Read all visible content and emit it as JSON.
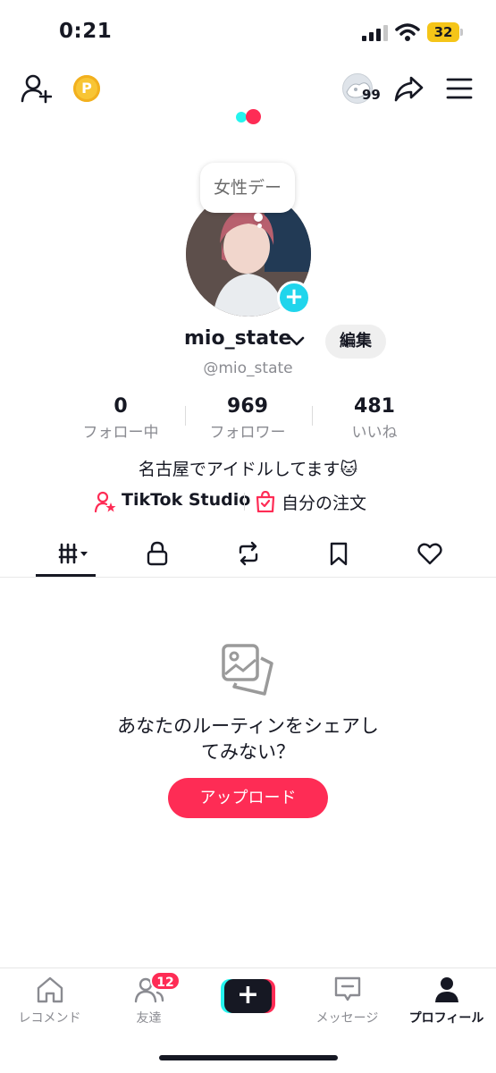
{
  "status_bar": {
    "time": "0:21",
    "battery": "32"
  },
  "top_nav": {
    "coin_label": "P",
    "visitor_count": "99"
  },
  "profile": {
    "note": "女性デー",
    "username": "mio_state",
    "handle": "@mio_state",
    "edit_label": "編集",
    "bio": "名古屋でアイドルしてます🐱",
    "studio_label": "TikTok Studio",
    "orders_label": "自分の注文"
  },
  "stats": [
    {
      "value": "0",
      "label": "フォロー中"
    },
    {
      "value": "969",
      "label": "フォロワー"
    },
    {
      "value": "481",
      "label": "いいね"
    }
  ],
  "tabs": [
    "videos-grid-icon",
    "lock-icon",
    "repost-icon",
    "bookmark-icon",
    "heart-icon"
  ],
  "empty_state": {
    "line1": "あなたのルーティンをシェアし",
    "line2": "てみない？",
    "upload_label": "アップロード"
  },
  "bottom_nav": {
    "items": [
      {
        "label": "レコメンド",
        "icon": "home-icon"
      },
      {
        "label": "友達",
        "icon": "friends-icon"
      },
      {
        "label": "+",
        "icon": "create-icon"
      },
      {
        "label": "メッセージ",
        "icon": "message-icon"
      },
      {
        "label": "プロフィール",
        "icon": "profile-icon"
      }
    ],
    "friends_badge": "12"
  },
  "colors": {
    "accent": "#fe2c55",
    "cyan": "#25f4ee",
    "text": "#161823",
    "muted": "#8a8b91"
  }
}
